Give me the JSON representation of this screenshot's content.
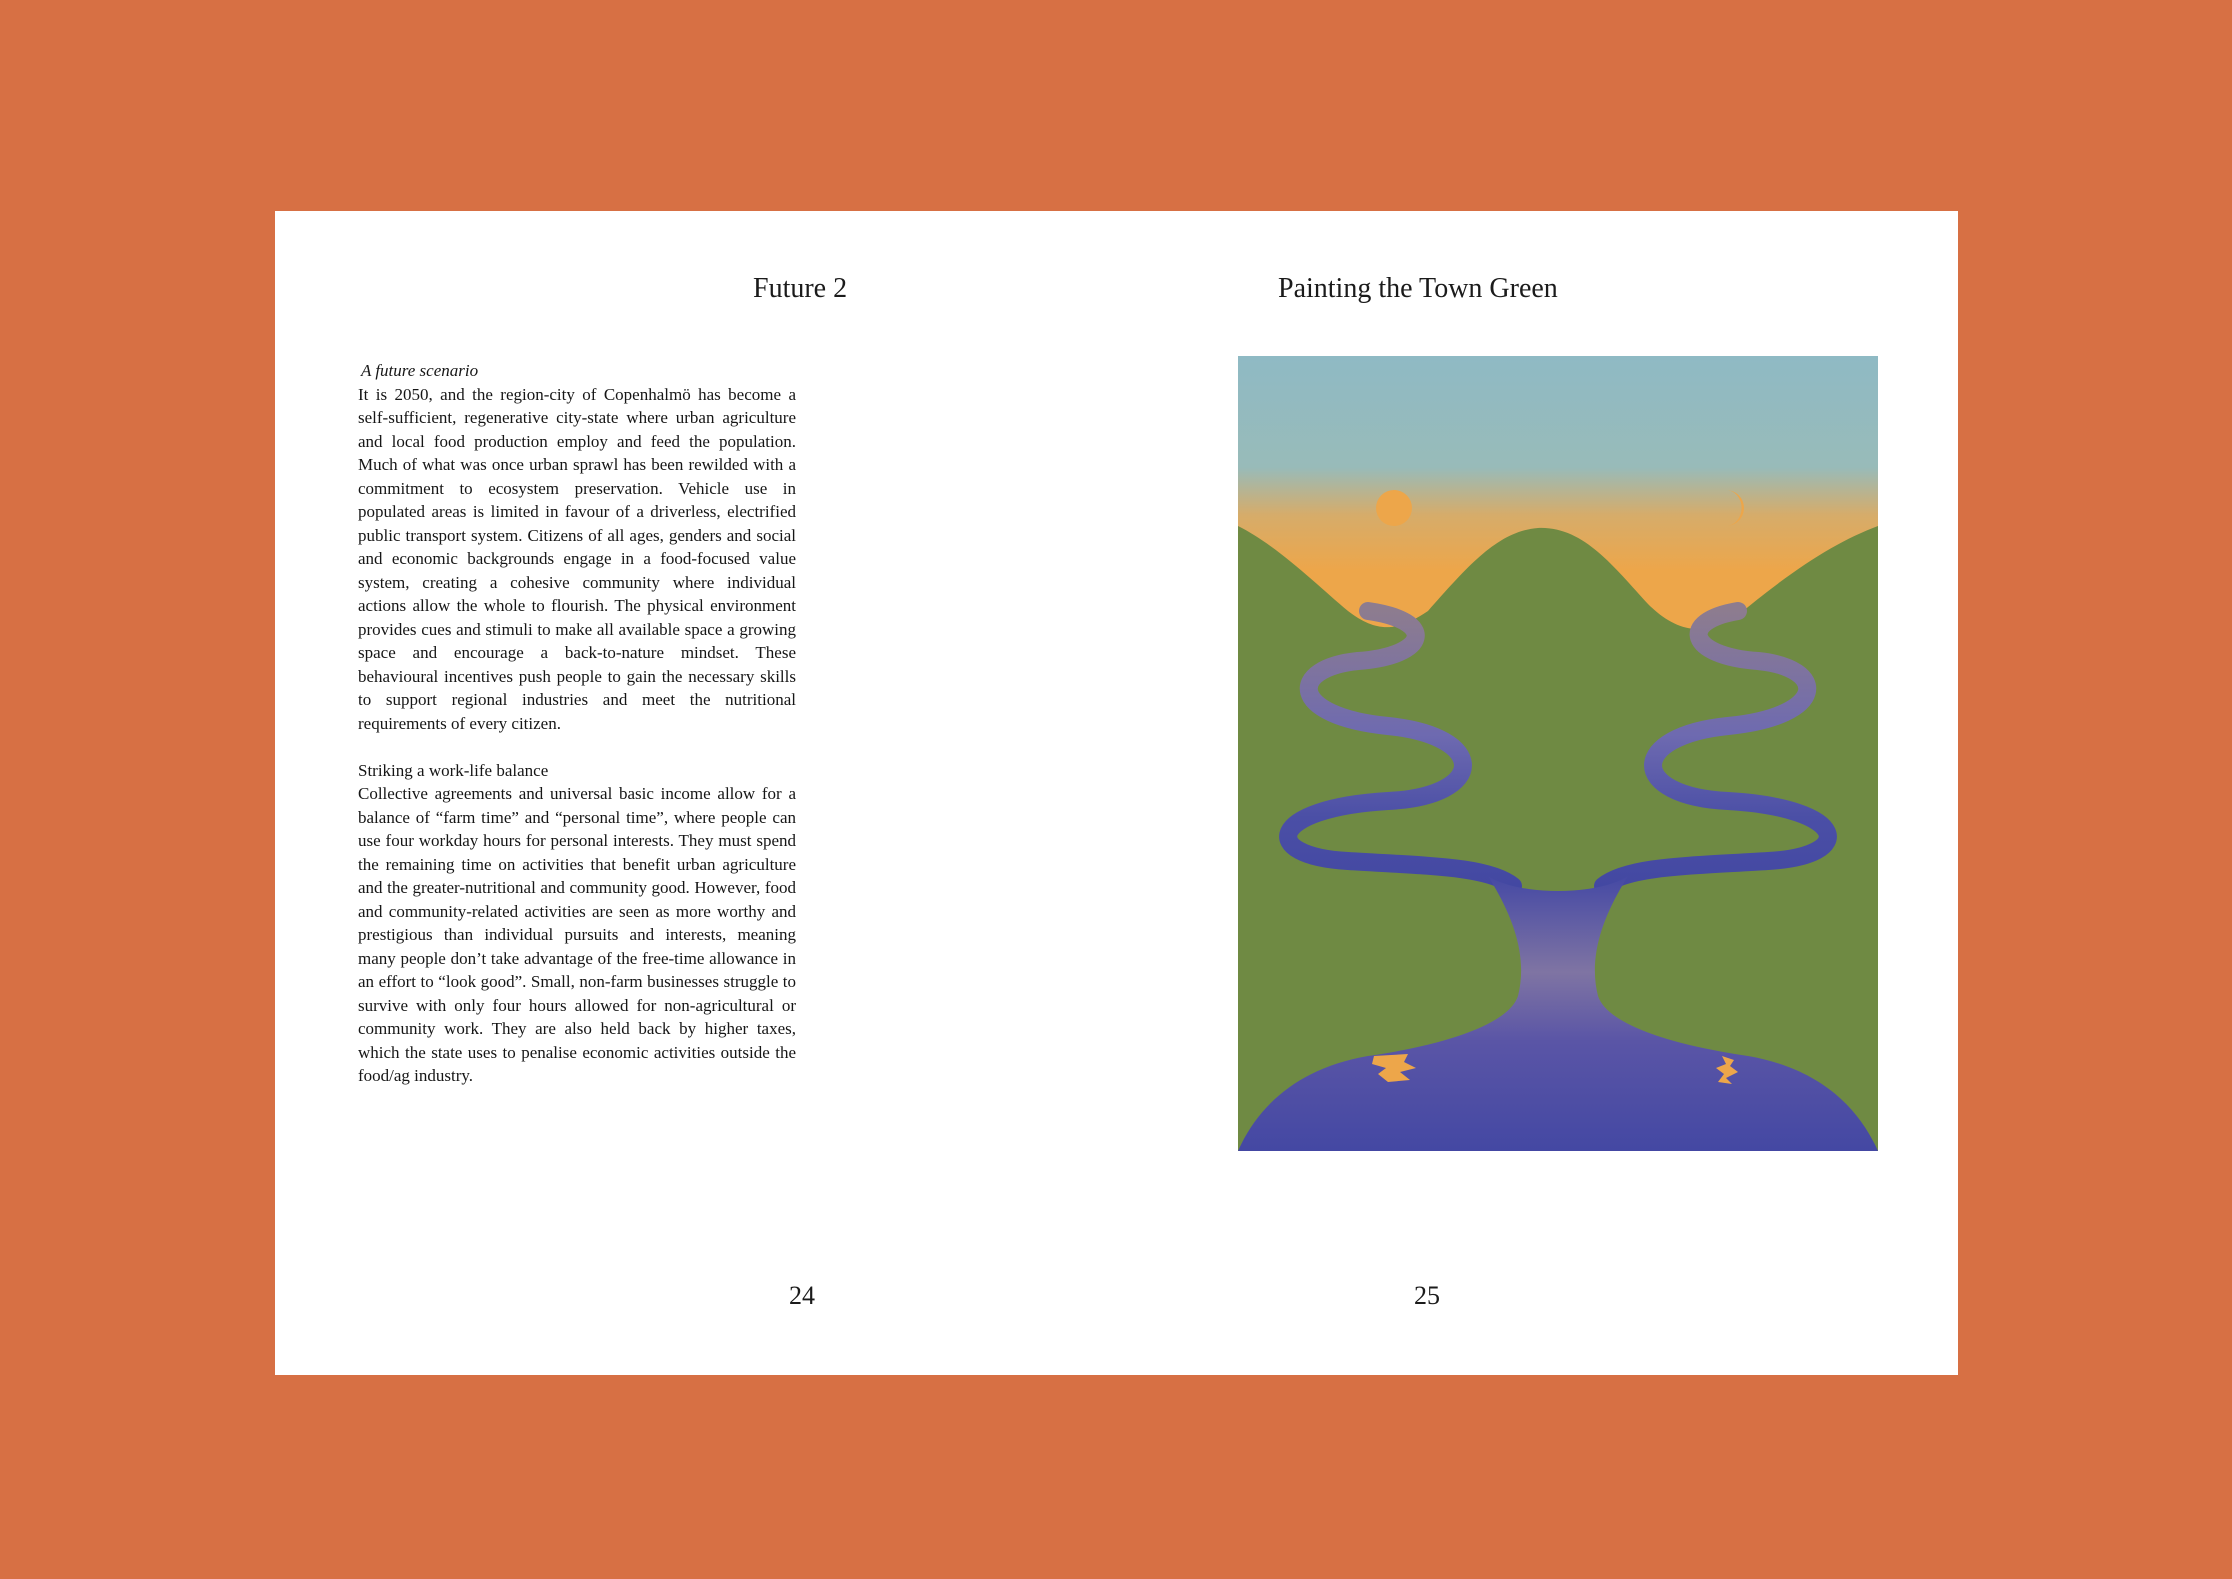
{
  "left_page": {
    "title": "Future 2",
    "page_number": "24",
    "sections": [
      {
        "heading": "A future scenario",
        "body": "It is 2050, and the region-city of Copenhalmö has become a self-sufficient, regenerative city-state where urban agriculture and local food production employ and feed the population. Much of what was once urban sprawl has been rewilded with a commitment to ecosystem preservation. Vehicle use in populated areas is limited in favour of a driverless, electrified public transport system. Citizens of all ages, genders and social and economic backgrounds engage in a food-focused value system, creating a cohesive community where individual actions allow the whole to flourish. The physical environment provides cues and stimuli to make all available space a growing space and encourage a back-to-nature mindset. These behavioural incentives push people to gain the necessary skills to support regional industries and meet the nutritional requirements of every citizen."
      },
      {
        "heading": "Striking a work-life balance",
        "body": "Collective agreements and universal basic income allow for a balance of “farm time” and “personal time”, where people can use four workday hours for personal interests. They must spend the remaining time on activities that benefit urban agriculture and the greater-nutritional and community good. However, food and community-related activities are seen as more worthy and prestigious than individual pursuits and interests, meaning many people don’t take advantage of the free-time allowance in an effort to “look good”. Small, non-farm businesses struggle to survive with only four hours allowed for non-agricultural or community work. They are also held back by higher taxes, which the state uses to penalise economic activities outside the food/ag industry."
      }
    ]
  },
  "right_page": {
    "title": "Painting the Town Green",
    "page_number": "25"
  },
  "colors": {
    "background": "#D77044",
    "page": "#FFFFFF",
    "sky_top": "#8FBAC4",
    "sky_horizon": "#EDA64A",
    "hills": "#6F8A43",
    "river": "#4B4FA6",
    "sun_moon": "#EDA64A"
  }
}
